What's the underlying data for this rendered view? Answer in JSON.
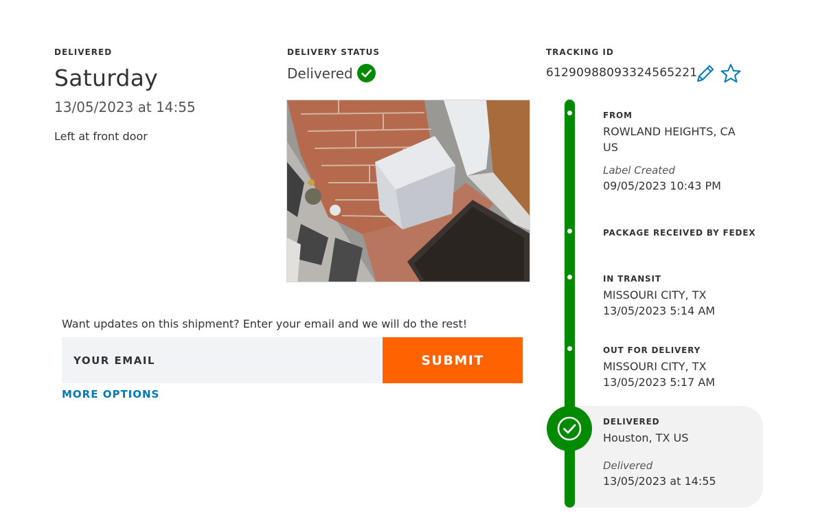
{
  "summary": {
    "delivered_label": "DELIVERED",
    "day": "Saturday",
    "datetime": "13/05/2023 at 14:55",
    "note": "Left at front door"
  },
  "status": {
    "label": "DELIVERY STATUS",
    "value": "Delivered",
    "color": "#008a00"
  },
  "tracking": {
    "label": "TRACKING ID",
    "number": "612909880933245652​21",
    "icons": [
      "pencil-icon",
      "star-icon"
    ],
    "accent_color": "#007ab7"
  },
  "updates": {
    "prompt": "Want updates on this shipment? Enter your email and we will do the rest!",
    "email_placeholder": "YOUR EMAIL",
    "submit_label": "SUBMIT",
    "submit_color": "#ff6200",
    "more_options": "MORE OPTIONS"
  },
  "timeline": {
    "from": {
      "label": "FROM",
      "line1": "ROWLAND HEIGHTS, CA",
      "line2": "US",
      "sublabel": "Label Created",
      "datetime": "09/05/2023 10:43 PM"
    },
    "received": {
      "label": "PACKAGE RECEIVED BY FEDEX"
    },
    "transit": {
      "label": "IN TRANSIT",
      "location": "MISSOURI CITY, TX",
      "datetime": "13/05/2023 5:14 AM"
    },
    "out": {
      "label": "OUT FOR DELIVERY",
      "location": "MISSOURI CITY, TX",
      "datetime": "13/05/2023 5:17 AM"
    },
    "delivered": {
      "label": "DELIVERED",
      "location": "Houston, TX US",
      "sublabel": "Delivered",
      "datetime": "13/05/2023 at 14:55"
    },
    "rail_color": "#008a00"
  }
}
